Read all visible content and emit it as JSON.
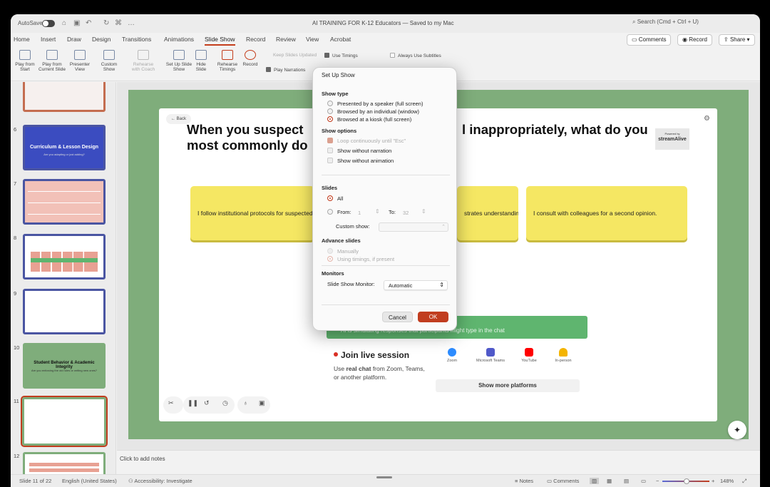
{
  "titlebar": {
    "autosave": "AutoSave",
    "doc_title": "AI TRAINING FOR K-12 Educators — Saved to my Mac",
    "search_placeholder": "Search (Cmd + Ctrl + U)"
  },
  "menu": [
    "Home",
    "Insert",
    "Draw",
    "Design",
    "Transitions",
    "Animations",
    "Slide Show",
    "Record",
    "Review",
    "View",
    "Acrobat"
  ],
  "top_buttons": {
    "comments": "Comments",
    "record": "Record",
    "share": "Share"
  },
  "ribbon": {
    "play_from_start": "Play from Start",
    "play_from_current": "Play from Current Slide",
    "presenter_view": "Presenter View",
    "custom_show": "Custom Show",
    "rehearse_coach": "Rehearse with Coach",
    "set_up": "Set Up Slide Show",
    "hide_slide": "Hide Slide",
    "rehearse_timings": "Rehearse Timings",
    "record": "Record",
    "keep_updated": "Keep Slides Updated",
    "use_timings": "Use Timings",
    "play_narrations": "Play Narrations",
    "always_subtitles": "Always Use Subtitles"
  },
  "thumbs": [
    {
      "num": "6",
      "title": "Curriculum & Lesson Design",
      "sub": "Are you adapting or just adding?"
    },
    {
      "num": "7"
    },
    {
      "num": "8"
    },
    {
      "num": "9"
    },
    {
      "num": "10",
      "title": "Student Behavior & Academic Integrity",
      "sub": "Are you enforcing the old rules or writing new ones?"
    },
    {
      "num": "11"
    },
    {
      "num": "12"
    }
  ],
  "slide": {
    "back": "Back",
    "question": "When you suspect a student used AI inappropriately, what do you most commonly do?",
    "question_visible_left": "When you suspect",
    "question_visible_right": "l inappropriately, what do you",
    "question_line2": "most commonly do",
    "powered_by": "Powered by",
    "brand": "streamAlive",
    "cards": [
      "I follow institutional protocols for suspected m",
      "strates understanding.",
      "I consult with colleagues for a second opinion."
    ],
    "banner": "AI is simulating responses that participants might type in the chat",
    "live_title": "Join live session",
    "live_text_pre": "Use ",
    "live_text_bold": "real chat",
    "live_text_post": " from Zoom, Teams, or another platform.",
    "platforms": [
      "Zoom",
      "Microsoft Teams",
      "YouTube",
      "In-person"
    ],
    "more_platforms": "Show more platforms"
  },
  "notes_placeholder": "Click to add notes",
  "status": {
    "slide": "Slide 11 of 22",
    "lang": "English (United States)",
    "accessibility": "Accessibility: Investigate",
    "notes": "Notes",
    "comments": "Comments",
    "zoom": "148%"
  },
  "dialog": {
    "title": "Set Up Show",
    "show_type": "Show type",
    "type_opts": [
      "Presented by a speaker (full screen)",
      "Browsed by an individual (window)",
      "Browsed at a kiosk (full screen)"
    ],
    "show_options": "Show options",
    "opt_loop": "Loop continuously until \"Esc\"",
    "opt_narration": "Show without narration",
    "opt_animation": "Show without animation",
    "slides": "Slides",
    "all": "All",
    "from": "From:",
    "from_val": "1",
    "to": "To:",
    "to_val": "32",
    "custom_show": "Custom show:",
    "advance": "Advance slides",
    "manually": "Manually",
    "using_timings": "Using timings, if present",
    "monitors": "Monitors",
    "monitor_label": "Slide Show Monitor:",
    "monitor_val": "Automatic",
    "cancel": "Cancel",
    "ok": "OK"
  }
}
